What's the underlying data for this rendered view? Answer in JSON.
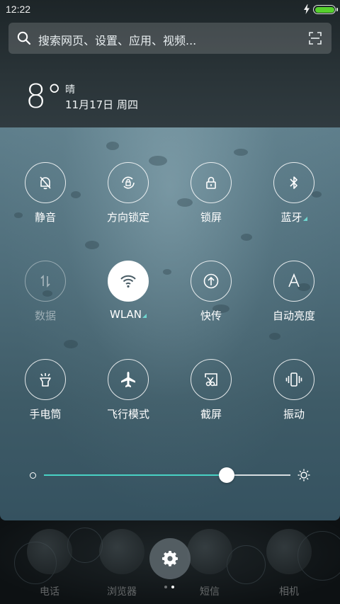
{
  "status_bar": {
    "time": "12:22",
    "battery_level": 1.0,
    "charging": true,
    "battery_color": "#56d02d"
  },
  "search": {
    "placeholder": "搜索网页、设置、应用、视频...",
    "search_icon": "search-icon",
    "scan_icon": "scan-icon"
  },
  "weather": {
    "temperature": "8°",
    "condition": "晴",
    "date": "11月17日 周四"
  },
  "toggles": [
    {
      "label": "静音",
      "icon": "bell-off-icon",
      "state": "off"
    },
    {
      "label": "方向锁定",
      "icon": "rotation-lock-icon",
      "state": "off"
    },
    {
      "label": "锁屏",
      "icon": "lock-icon",
      "state": "off"
    },
    {
      "label": "蓝牙",
      "icon": "bluetooth-icon",
      "state": "off",
      "has_more": true
    },
    {
      "label": "数据",
      "icon": "mobile-data-icon",
      "state": "disabled"
    },
    {
      "label": "WLAN",
      "icon": "wifi-icon",
      "state": "on",
      "has_more": true
    },
    {
      "label": "快传",
      "icon": "quick-transfer-icon",
      "state": "off"
    },
    {
      "label": "自动亮度",
      "icon": "auto-brightness-icon",
      "state": "off"
    },
    {
      "label": "手电筒",
      "icon": "flashlight-icon",
      "state": "off"
    },
    {
      "label": "飞行模式",
      "icon": "airplane-icon",
      "state": "off"
    },
    {
      "label": "截屏",
      "icon": "screenshot-icon",
      "state": "off"
    },
    {
      "label": "振动",
      "icon": "vibrate-icon",
      "state": "off"
    }
  ],
  "brightness": {
    "level": 0.74,
    "accent_color": "#49d2c4"
  },
  "dock": {
    "apps": [
      "电话",
      "浏览器",
      "短信",
      "相机"
    ],
    "settings_icon": "gear-icon",
    "pages": 2,
    "current_page": 2
  }
}
